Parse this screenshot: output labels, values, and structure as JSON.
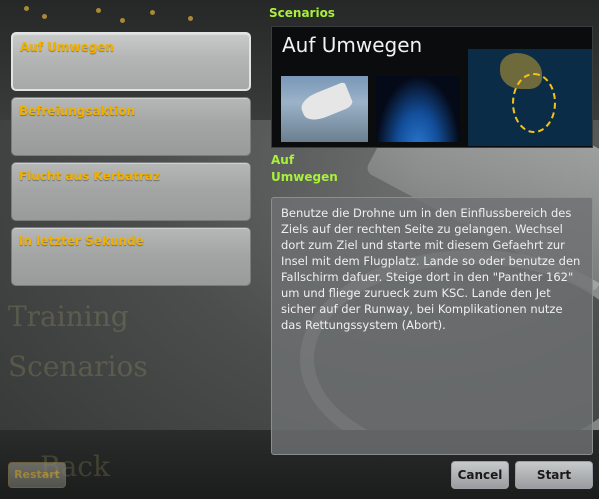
{
  "header": {
    "title": "Scenarios"
  },
  "scenarios": [
    {
      "label": "Auf Umwegen",
      "selected": true
    },
    {
      "label": "Befreiungsaktion",
      "selected": false
    },
    {
      "label": "Flucht aus Kerbatraz",
      "selected": false
    },
    {
      "label": "In letzter Sekunde",
      "selected": false
    }
  ],
  "preview": {
    "title": "Auf Umwegen",
    "thumbnails": [
      "plane-thumbnail",
      "orbit-thumbnail",
      "map-thumbnail"
    ]
  },
  "selected_scenario": {
    "name": "Auf Umwegen",
    "description": "Benutze die Drohne um in den Einflussbereich des Ziels auf der rechten Seite zu gelangen. Wechsel dort zum Ziel und starte mit diesem Gefaehrt zur Insel mit dem Flugplatz. Lande so oder benutze den Fallschirm dafuer. Steige dort in den \"Panther 162\" um und fliege zurueck zum KSC. Lande den Jet sicher auf der Runway, bei Komplikationen nutze das Rettungssystem (Abort)."
  },
  "background": {
    "faint_text": [
      "Training",
      "Scenarios",
      "Back"
    ]
  },
  "buttons": {
    "restart": "Restart",
    "cancel": "Cancel",
    "start": "Start"
  },
  "colors": {
    "accent_green": "#a8f03a",
    "label_gold": "#f2b100"
  }
}
